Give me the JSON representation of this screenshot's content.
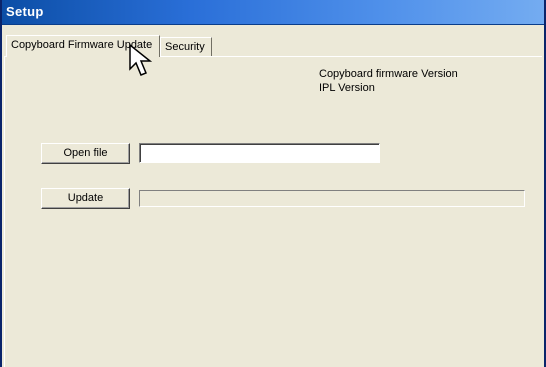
{
  "window": {
    "title": "Setup"
  },
  "tabs": [
    {
      "label": "Copyboard Firmware Update",
      "active": true
    },
    {
      "label": "Security",
      "active": false
    }
  ],
  "versions": {
    "firmware_label": "Copyboard firmware Version",
    "ipl_label": "IPL Version"
  },
  "open_file": {
    "button_label": "Open file",
    "path_value": ""
  },
  "update": {
    "button_label": "Update",
    "progress_fraction": 0
  },
  "cursor": {
    "icon": "arrow-cursor-icon"
  },
  "colors": {
    "titlebar_start": "#0c4ea6",
    "titlebar_end": "#74acf1",
    "face": "#ece9d8"
  }
}
